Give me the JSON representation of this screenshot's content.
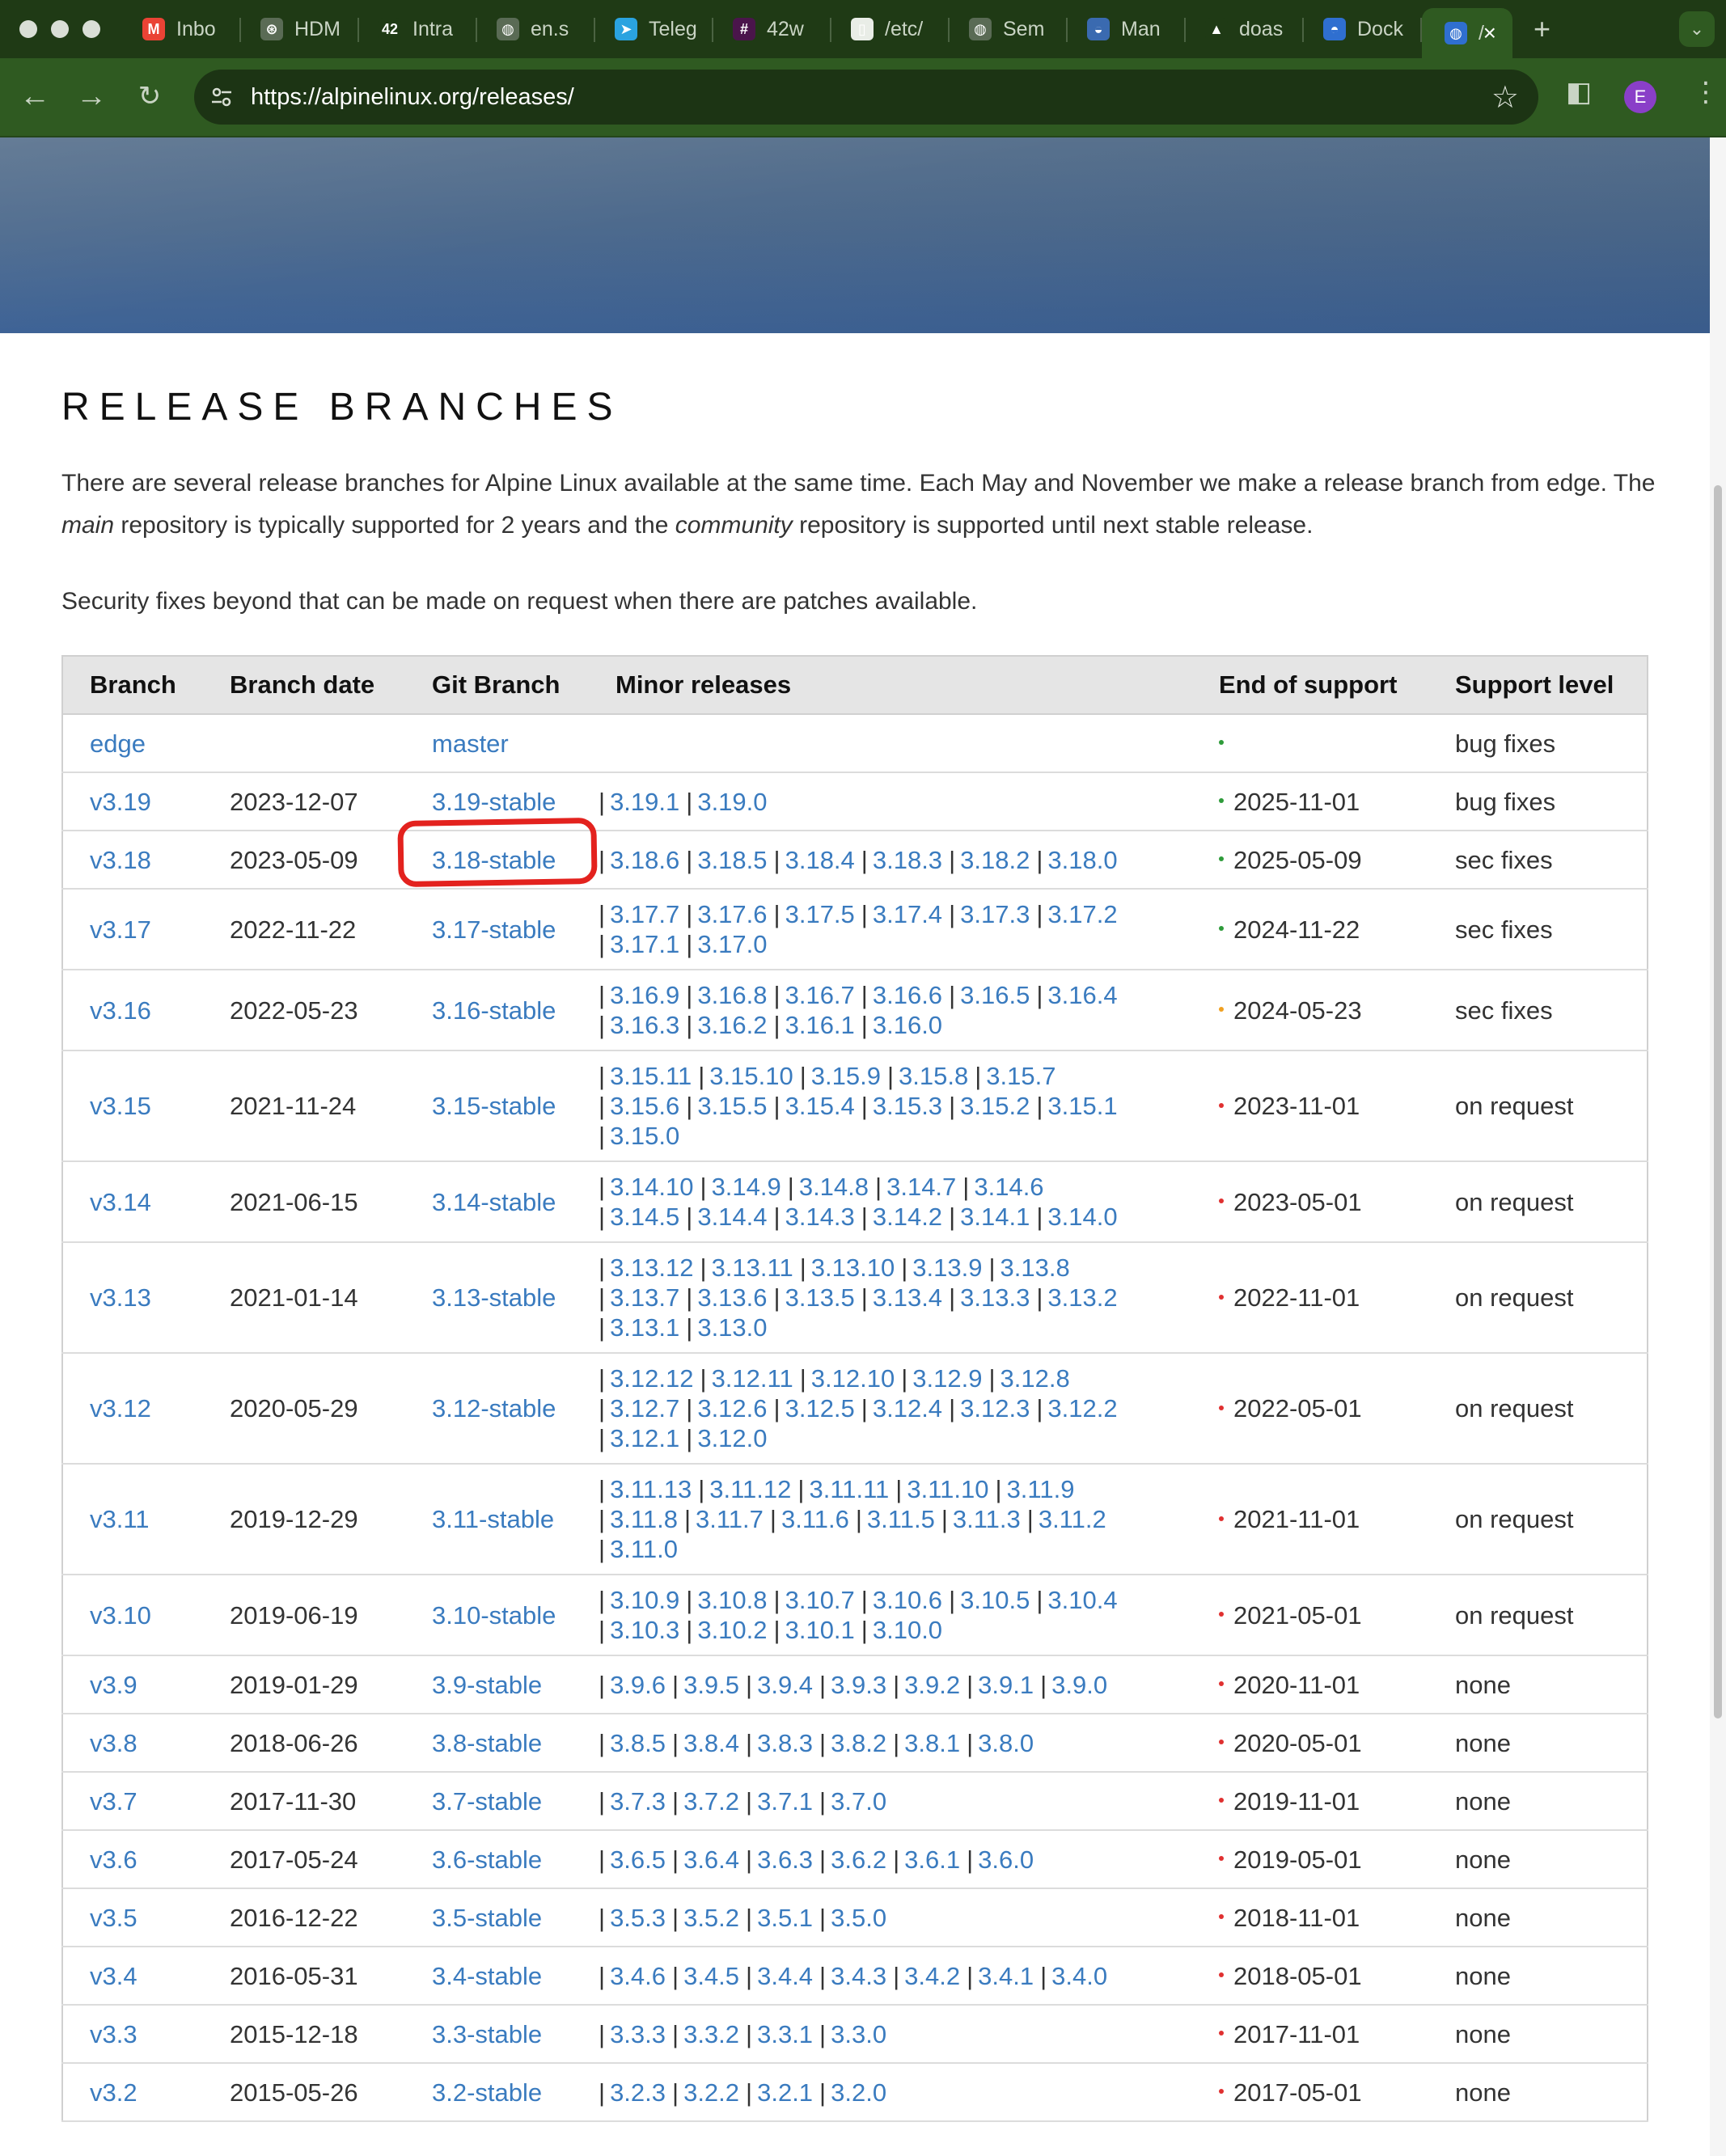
{
  "browser": {
    "tabs": [
      {
        "title": "Inbo",
        "icon": "gmail-icon",
        "color": "#ea4335",
        "glyph": "M"
      },
      {
        "title": "HDM",
        "icon": "openai-icon",
        "color": "#5a6b55",
        "glyph": "⊛"
      },
      {
        "title": "Intra",
        "icon": "42-icon",
        "color": "#1f3a15",
        "glyph": "42"
      },
      {
        "title": "en.s",
        "icon": "globe-icon",
        "color": "#5a6b55",
        "glyph": "◍"
      },
      {
        "title": "Teleg",
        "icon": "telegram-icon",
        "color": "#2aa3e0",
        "glyph": "➤"
      },
      {
        "title": "42w",
        "icon": "slack-icon",
        "color": "#4a154b",
        "glyph": "#"
      },
      {
        "title": "/etc/",
        "icon": "document-icon",
        "color": "#e9ede7",
        "glyph": "▯"
      },
      {
        "title": "Sem",
        "icon": "globe-icon",
        "color": "#5a6b55",
        "glyph": "◍"
      },
      {
        "title": "Man",
        "icon": "manual-icon",
        "color": "#3a6ab0",
        "glyph": "◒"
      },
      {
        "title": "doas",
        "icon": "arch-icon",
        "color": "#1f3a15",
        "glyph": "▲"
      },
      {
        "title": "Dock",
        "icon": "docker-icon",
        "color": "#2f6fd0",
        "glyph": "◓"
      },
      {
        "title": "/",
        "icon": "alpine-icon",
        "color": "#2f6fd0",
        "glyph": "◍"
      }
    ],
    "url": "https://alpinelinux.org/releases/",
    "profile_initial": "E"
  },
  "page": {
    "heading": "RELEASE BRANCHES",
    "para1_a": "There are several release branches for Alpine Linux available at the same time. Each May and November we make a release branch from edge. The ",
    "para1_main": "main",
    "para1_b": " repository is typically supported for 2 years and the ",
    "para1_community": "community",
    "para1_c": " repository is supported until next stable release.",
    "para2": "Security fixes beyond that can be made on request when there are patches available."
  },
  "table": {
    "headers": [
      "Branch",
      "Branch date",
      "Git Branch",
      "Minor releases",
      "End of support",
      "Support level"
    ],
    "status_colors": {
      "green": "#2e9b3a",
      "orange": "#f0a020",
      "red": "#e03030"
    },
    "rows": [
      {
        "branch": "edge",
        "date": "",
        "git": "master",
        "minors": [],
        "eos": "",
        "status": "green",
        "level": "bug fixes"
      },
      {
        "branch": "v3.19",
        "date": "2023-12-07",
        "git": "3.19-stable",
        "minors": [
          [
            "3.19.1",
            "3.19.0"
          ]
        ],
        "eos": "2025-11-01",
        "status": "green",
        "level": "bug fixes"
      },
      {
        "branch": "v3.18",
        "date": "2023-05-09",
        "git": "3.18-stable",
        "minors": [
          [
            "3.18.6",
            "3.18.5",
            "3.18.4",
            "3.18.3",
            "3.18.2",
            "3.18.0"
          ]
        ],
        "eos": "2025-05-09",
        "status": "green",
        "level": "sec fixes"
      },
      {
        "branch": "v3.17",
        "date": "2022-11-22",
        "git": "3.17-stable",
        "minors": [
          [
            "3.17.7",
            "3.17.6",
            "3.17.5",
            "3.17.4",
            "3.17.3",
            "3.17.2"
          ],
          [
            "3.17.1",
            "3.17.0"
          ]
        ],
        "eos": "2024-11-22",
        "status": "green",
        "level": "sec fixes"
      },
      {
        "branch": "v3.16",
        "date": "2022-05-23",
        "git": "3.16-stable",
        "minors": [
          [
            "3.16.9",
            "3.16.8",
            "3.16.7",
            "3.16.6",
            "3.16.5",
            "3.16.4"
          ],
          [
            "3.16.3",
            "3.16.2",
            "3.16.1",
            "3.16.0"
          ]
        ],
        "eos": "2024-05-23",
        "status": "orange",
        "level": "sec fixes"
      },
      {
        "branch": "v3.15",
        "date": "2021-11-24",
        "git": "3.15-stable",
        "minors": [
          [
            "3.15.11",
            "3.15.10",
            "3.15.9",
            "3.15.8",
            "3.15.7"
          ],
          [
            "3.15.6",
            "3.15.5",
            "3.15.4",
            "3.15.3",
            "3.15.2",
            "3.15.1"
          ],
          [
            "3.15.0"
          ]
        ],
        "eos": "2023-11-01",
        "status": "red",
        "level": "on request"
      },
      {
        "branch": "v3.14",
        "date": "2021-06-15",
        "git": "3.14-stable",
        "minors": [
          [
            "3.14.10",
            "3.14.9",
            "3.14.8",
            "3.14.7",
            "3.14.6"
          ],
          [
            "3.14.5",
            "3.14.4",
            "3.14.3",
            "3.14.2",
            "3.14.1",
            "3.14.0"
          ]
        ],
        "eos": "2023-05-01",
        "status": "red",
        "level": "on request"
      },
      {
        "branch": "v3.13",
        "date": "2021-01-14",
        "git": "3.13-stable",
        "minors": [
          [
            "3.13.12",
            "3.13.11",
            "3.13.10",
            "3.13.9",
            "3.13.8"
          ],
          [
            "3.13.7",
            "3.13.6",
            "3.13.5",
            "3.13.4",
            "3.13.3",
            "3.13.2"
          ],
          [
            "3.13.1",
            "3.13.0"
          ]
        ],
        "eos": "2022-11-01",
        "status": "red",
        "level": "on request"
      },
      {
        "branch": "v3.12",
        "date": "2020-05-29",
        "git": "3.12-stable",
        "minors": [
          [
            "3.12.12",
            "3.12.11",
            "3.12.10",
            "3.12.9",
            "3.12.8"
          ],
          [
            "3.12.7",
            "3.12.6",
            "3.12.5",
            "3.12.4",
            "3.12.3",
            "3.12.2"
          ],
          [
            "3.12.1",
            "3.12.0"
          ]
        ],
        "eos": "2022-05-01",
        "status": "red",
        "level": "on request"
      },
      {
        "branch": "v3.11",
        "date": "2019-12-29",
        "git": "3.11-stable",
        "minors": [
          [
            "3.11.13",
            "3.11.12",
            "3.11.11",
            "3.11.10",
            "3.11.9"
          ],
          [
            "3.11.8",
            "3.11.7",
            "3.11.6",
            "3.11.5",
            "3.11.3",
            "3.11.2"
          ],
          [
            "3.11.0"
          ]
        ],
        "eos": "2021-11-01",
        "status": "red",
        "level": "on request"
      },
      {
        "branch": "v3.10",
        "date": "2019-06-19",
        "git": "3.10-stable",
        "minors": [
          [
            "3.10.9",
            "3.10.8",
            "3.10.7",
            "3.10.6",
            "3.10.5",
            "3.10.4"
          ],
          [
            "3.10.3",
            "3.10.2",
            "3.10.1",
            "3.10.0"
          ]
        ],
        "eos": "2021-05-01",
        "status": "red",
        "level": "on request"
      },
      {
        "branch": "v3.9",
        "date": "2019-01-29",
        "git": "3.9-stable",
        "minors": [
          [
            "3.9.6",
            "3.9.5",
            "3.9.4",
            "3.9.3",
            "3.9.2",
            "3.9.1",
            "3.9.0"
          ]
        ],
        "eos": "2020-11-01",
        "status": "red",
        "level": "none"
      },
      {
        "branch": "v3.8",
        "date": "2018-06-26",
        "git": "3.8-stable",
        "minors": [
          [
            "3.8.5",
            "3.8.4",
            "3.8.3",
            "3.8.2",
            "3.8.1",
            "3.8.0"
          ]
        ],
        "eos": "2020-05-01",
        "status": "red",
        "level": "none"
      },
      {
        "branch": "v3.7",
        "date": "2017-11-30",
        "git": "3.7-stable",
        "minors": [
          [
            "3.7.3",
            "3.7.2",
            "3.7.1",
            "3.7.0"
          ]
        ],
        "eos": "2019-11-01",
        "status": "red",
        "level": "none"
      },
      {
        "branch": "v3.6",
        "date": "2017-05-24",
        "git": "3.6-stable",
        "minors": [
          [
            "3.6.5",
            "3.6.4",
            "3.6.3",
            "3.6.2",
            "3.6.1",
            "3.6.0"
          ]
        ],
        "eos": "2019-05-01",
        "status": "red",
        "level": "none"
      },
      {
        "branch": "v3.5",
        "date": "2016-12-22",
        "git": "3.5-stable",
        "minors": [
          [
            "3.5.3",
            "3.5.2",
            "3.5.1",
            "3.5.0"
          ]
        ],
        "eos": "2018-11-01",
        "status": "red",
        "level": "none"
      },
      {
        "branch": "v3.4",
        "date": "2016-05-31",
        "git": "3.4-stable",
        "minors": [
          [
            "3.4.6",
            "3.4.5",
            "3.4.4",
            "3.4.3",
            "3.4.2",
            "3.4.1",
            "3.4.0"
          ]
        ],
        "eos": "2018-05-01",
        "status": "red",
        "level": "none"
      },
      {
        "branch": "v3.3",
        "date": "2015-12-18",
        "git": "3.3-stable",
        "minors": [
          [
            "3.3.3",
            "3.3.2",
            "3.3.1",
            "3.3.0"
          ]
        ],
        "eos": "2017-11-01",
        "status": "red",
        "level": "none"
      },
      {
        "branch": "v3.2",
        "date": "2015-05-26",
        "git": "3.2-stable",
        "minors": [
          [
            "3.2.3",
            "3.2.2",
            "3.2.1",
            "3.2.0"
          ]
        ],
        "eos": "2017-05-01",
        "status": "red",
        "level": "none"
      }
    ]
  }
}
